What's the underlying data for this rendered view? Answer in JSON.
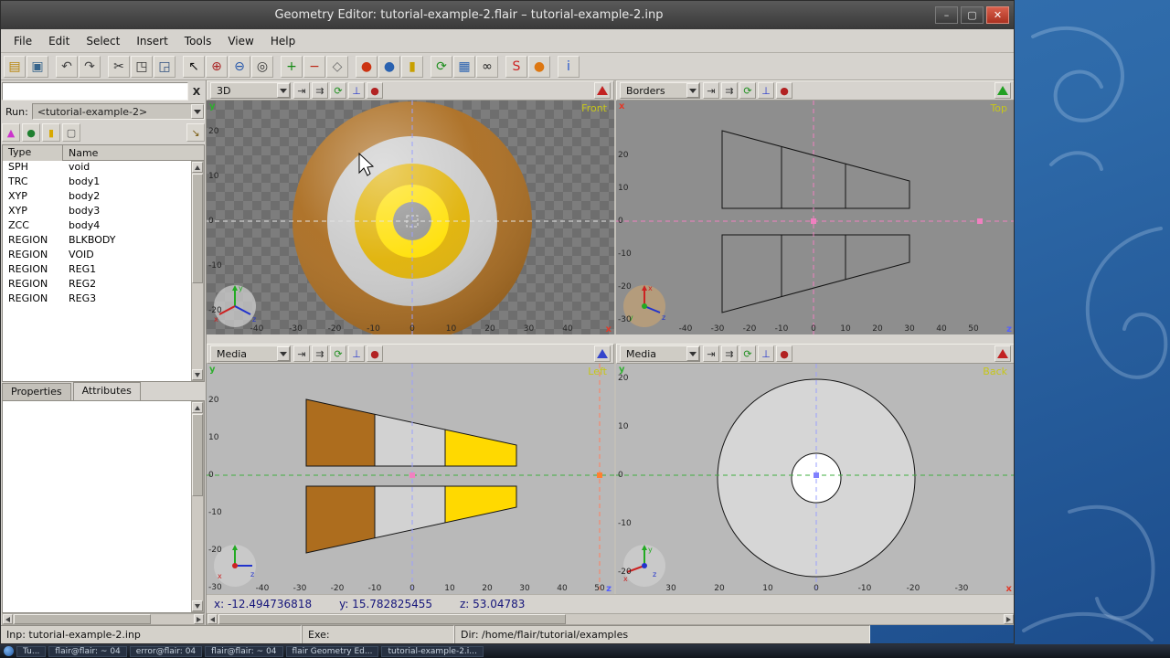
{
  "titlebar": {
    "title": "Geometry Editor: tutorial-example-2.flair – tutorial-example-2.inp",
    "minimize": "–",
    "maximize": "▢",
    "close": "✕"
  },
  "menubar": {
    "items": [
      "File",
      "Edit",
      "Select",
      "Insert",
      "Tools",
      "View",
      "Help"
    ]
  },
  "toolbar": {
    "buttons": [
      {
        "name": "open-button",
        "glyph": "▤",
        "color": "#b8860b"
      },
      {
        "name": "save-button",
        "glyph": "▣",
        "color": "#36648b"
      },
      {
        "sep": true
      },
      {
        "name": "undo-button",
        "glyph": "↶",
        "color": "#444444"
      },
      {
        "name": "redo-button",
        "glyph": "↷",
        "color": "#444444"
      },
      {
        "sep": true
      },
      {
        "name": "cut-button",
        "glyph": "✂",
        "color": "#333333"
      },
      {
        "name": "copy-button",
        "glyph": "◳",
        "color": "#333333"
      },
      {
        "name": "paste-button",
        "glyph": "◲",
        "color": "#2f4f7f"
      },
      {
        "sep": true
      },
      {
        "name": "select-button",
        "glyph": "↖",
        "color": "#111111"
      },
      {
        "name": "zoom-in-button",
        "glyph": "⊕",
        "color": "#aa2222"
      },
      {
        "name": "zoom-out-button",
        "glyph": "⊖",
        "color": "#2255aa"
      },
      {
        "name": "center-button",
        "glyph": "◎",
        "color": "#333333"
      },
      {
        "sep": true
      },
      {
        "name": "add-button",
        "glyph": "+",
        "color": "#118811"
      },
      {
        "name": "remove-button",
        "glyph": "−",
        "color": "#bb2211"
      },
      {
        "name": "rotate-button",
        "glyph": "◇",
        "color": "#666666"
      },
      {
        "sep": true
      },
      {
        "name": "material-red-button",
        "glyph": "●",
        "color": "#cc3311"
      },
      {
        "name": "material-blue-button",
        "glyph": "●",
        "color": "#2a62b0"
      },
      {
        "name": "lock-button",
        "glyph": "▮",
        "color": "#c8a000"
      },
      {
        "sep": true
      },
      {
        "name": "refresh-button",
        "glyph": "⟳",
        "color": "#1f8f1f"
      },
      {
        "name": "palette-button",
        "glyph": "▦",
        "color": "#2a62b0"
      },
      {
        "name": "stereo-button",
        "glyph": "∞",
        "color": "#222222"
      },
      {
        "sep": true
      },
      {
        "name": "export-button",
        "glyph": "S",
        "color": "#cc2222"
      },
      {
        "name": "sphere-button",
        "glyph": "●",
        "color": "#dd7711"
      },
      {
        "sep": true
      },
      {
        "name": "info-button",
        "glyph": "i",
        "color": "#2255cc"
      }
    ]
  },
  "sidebar": {
    "filter_value": "",
    "filter_close": "X",
    "run_label": "Run:",
    "run_value": "<tutorial-example-2>",
    "tools": [
      {
        "name": "zone-tool-button",
        "glyph": "▲",
        "color": "#cc33cc"
      },
      {
        "name": "material-tool-button",
        "glyph": "●",
        "color": "#1f7f2f"
      },
      {
        "name": "lock-tool-button",
        "glyph": "▮",
        "color": "#d8a800"
      },
      {
        "name": "note-tool-button",
        "glyph": "▢",
        "color": "#555555"
      },
      {
        "name": "pin-tool-button",
        "glyph": "↘",
        "color": "#7a5c10",
        "right": true
      }
    ],
    "table": {
      "columns": [
        "Type",
        "Name"
      ],
      "rows": [
        [
          "SPH",
          "void"
        ],
        [
          "TRC",
          "body1"
        ],
        [
          "XYP",
          "body2"
        ],
        [
          "XYP",
          "body3"
        ],
        [
          "ZCC",
          "body4"
        ],
        [
          "REGION",
          "BLKBODY"
        ],
        [
          "REGION",
          "VOID"
        ],
        [
          "REGION",
          "REG1"
        ],
        [
          "REGION",
          "REG2"
        ],
        [
          "REGION",
          "REG3"
        ]
      ]
    },
    "tabs": [
      "Properties",
      "Attributes"
    ],
    "active_tab": "Attributes"
  },
  "viewports": {
    "header_buttons": [
      {
        "name": "focus-button",
        "glyph": "⇥",
        "color": "#333333"
      },
      {
        "name": "forward-button",
        "glyph": "⇉",
        "color": "#333333"
      },
      {
        "name": "reload-button",
        "glyph": "⟳",
        "color": "#1f8f1f"
      },
      {
        "name": "axes-button",
        "glyph": "⊥",
        "color": "#2233cc"
      },
      {
        "name": "insect-button",
        "glyph": "●",
        "color": "#b22222"
      }
    ],
    "v3d": {
      "title": "3D",
      "view": "Front",
      "vaxis": "y",
      "haxis": "x",
      "hticks": [
        "-40",
        "-30",
        "-20",
        "-10",
        "0",
        "10",
        "20",
        "30",
        "40"
      ],
      "vticks": [
        "20",
        "10",
        "0",
        "-10",
        "-20"
      ]
    },
    "borders": {
      "title": "Borders",
      "view": "Top",
      "vaxis": "x",
      "haxis": "z",
      "hticks": [
        "-40",
        "-30",
        "-20",
        "-10",
        "0",
        "10",
        "20",
        "30",
        "40",
        "50"
      ],
      "vticks": [
        "20",
        "10",
        "0",
        "-10",
        "-20",
        "-30"
      ]
    },
    "mleft": {
      "title": "Media",
      "view": "Left",
      "vaxis": "y",
      "haxis": "z",
      "hticks": [
        "-40",
        "-30",
        "-20",
        "-10",
        "0",
        "10",
        "20",
        "30",
        "40",
        "50"
      ],
      "vticks": [
        "20",
        "10",
        "0",
        "-10",
        "-20",
        "-30"
      ]
    },
    "mback": {
      "title": "Media",
      "view": "Back",
      "vaxis": "y",
      "haxis": "x",
      "hticks": [
        "30",
        "20",
        "10",
        "0",
        "-10",
        "-20",
        "-30"
      ],
      "vticks": [
        "20",
        "10",
        "0",
        "-10",
        "-20"
      ]
    }
  },
  "statusbar": {
    "x": "x: -12.494736818",
    "y": "y: 15.782825455",
    "z": "z: 53.04783"
  },
  "bottombar": {
    "inp": "Inp: tutorial-example-2.inp",
    "exe": "Exe:",
    "dir": "Dir: /home/flair/tutorial/examples"
  },
  "taskbar": {
    "items": [
      "Tu...",
      "flair@flair: ~ 04",
      "error@flair: 04",
      "flair@flair: ~ 04",
      "flair Geometry Ed...",
      "tutorial-example-2.i..."
    ]
  },
  "colors": {
    "target_orange": "#a96a1c",
    "target_gray": "#c9c9c9",
    "target_gold": "#dfb000",
    "target_yellow": "#ffdf00",
    "triangle_3d": "#c22222",
    "triangle_borders": "#22a022",
    "triangle_media_left": "#3344cc",
    "triangle_media_back": "#c22222"
  }
}
